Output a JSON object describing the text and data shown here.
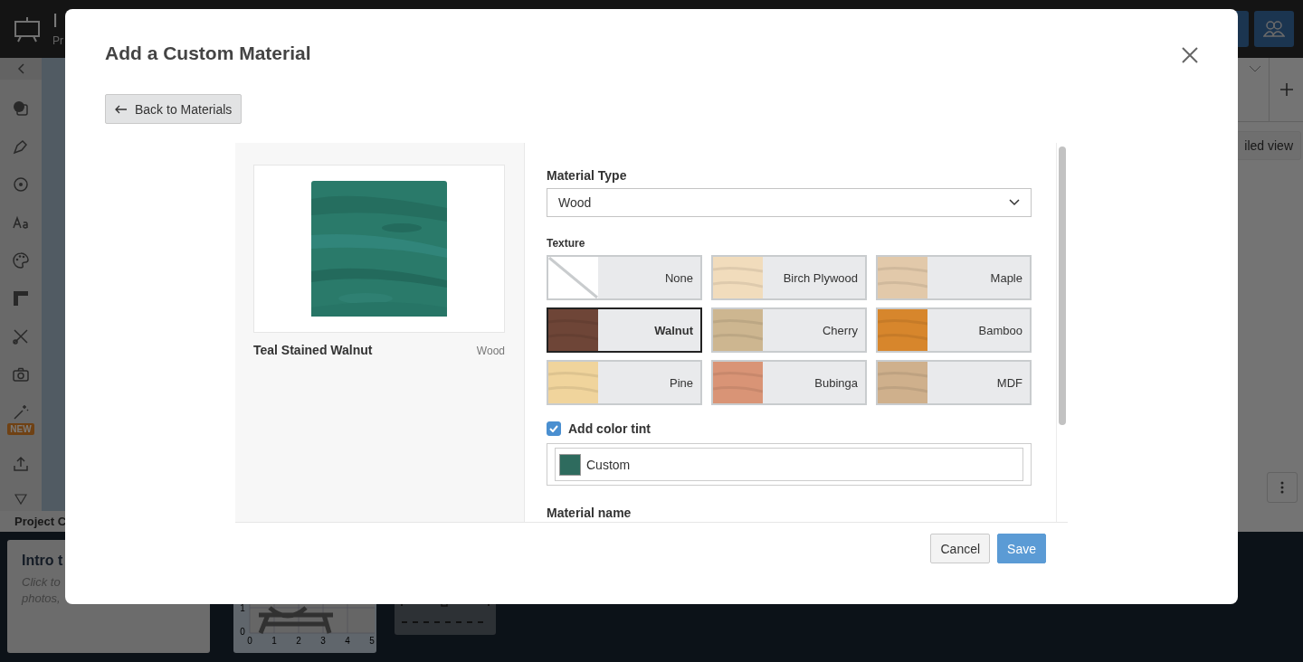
{
  "app": {
    "title": "I",
    "subtitle": "Pr",
    "sidebar_badge": "NEW",
    "right_panel_button": "iled view",
    "project_label": "Project C",
    "intro_card": {
      "title": "Intro t",
      "lines": [
        "Click to",
        "photos,"
      ]
    },
    "thumbnail": {
      "x_labels": [
        "0",
        "1",
        "2",
        "3",
        "4",
        "5"
      ],
      "y_labels": [
        "1",
        "0"
      ]
    }
  },
  "dialog": {
    "title": "Add a Custom Material",
    "back_button": "Back to Materials",
    "preview": {
      "name": "Teal Stained Walnut",
      "type": "Wood"
    },
    "material_type": {
      "label": "Material Type",
      "value": "Wood"
    },
    "texture_label": "Texture",
    "textures": [
      {
        "label": "None",
        "kind": "none",
        "selected": false
      },
      {
        "label": "Birch Plywood",
        "kind": "wood",
        "color": "#f1dcbc",
        "selected": false
      },
      {
        "label": "Maple",
        "kind": "wood",
        "color": "#e2c9aa",
        "selected": false
      },
      {
        "label": "Walnut",
        "kind": "wood",
        "color": "#6e4537",
        "selected": true
      },
      {
        "label": "Cherry",
        "kind": "wood",
        "color": "#cdb690",
        "selected": false
      },
      {
        "label": "Bamboo",
        "kind": "wood",
        "color": "#d7862c",
        "selected": false
      },
      {
        "label": "Pine",
        "kind": "wood",
        "color": "#f0d49c",
        "selected": false
      },
      {
        "label": "Bubinga",
        "kind": "wood",
        "color": "#d99476",
        "selected": false
      },
      {
        "label": "MDF",
        "kind": "wood",
        "color": "#cfb08c",
        "selected": false
      }
    ],
    "color_tint": {
      "label": "Add color tint",
      "checked": true,
      "color": "#2e6b5e",
      "value": "Custom"
    },
    "material_name_label": "Material name",
    "buttons": [
      {
        "label": "Cancel",
        "kind": "secondary"
      },
      {
        "label": "Save",
        "kind": "primary"
      }
    ]
  }
}
